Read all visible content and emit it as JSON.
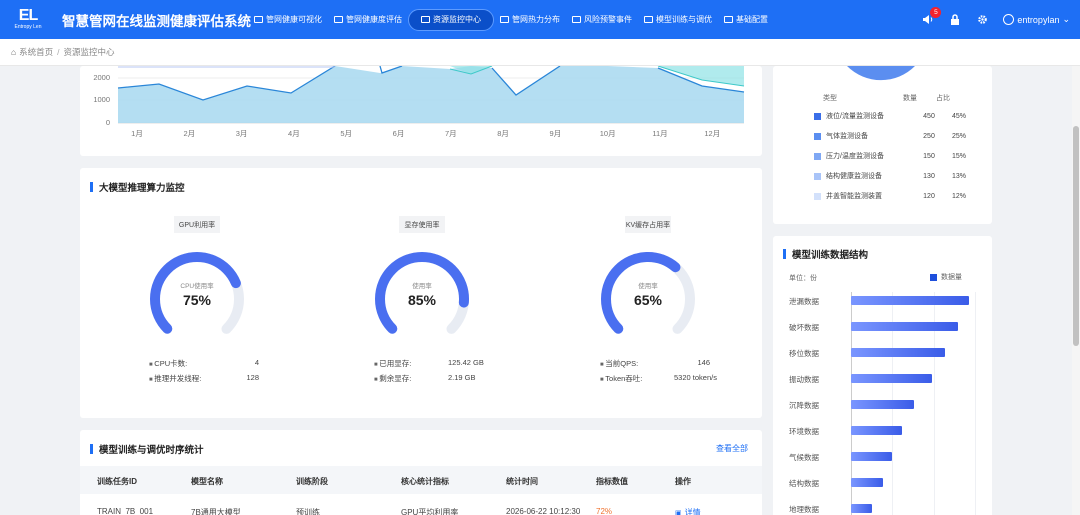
{
  "app": {
    "logo_mark": "EL",
    "logo_sub": "Entropy Len",
    "title": "智慧管网在线监测健康评估系统"
  },
  "nav": [
    {
      "label": "管网健康可视化",
      "icon": "dashboard-icon"
    },
    {
      "label": "管网健康度评估",
      "icon": "clipboard-icon"
    },
    {
      "label": "资源监控中心",
      "icon": "gear-icon",
      "active": true
    },
    {
      "label": "管网热力分布",
      "icon": "heat-icon"
    },
    {
      "label": "风险预警事件",
      "icon": "bell-icon"
    },
    {
      "label": "模型训练与调优",
      "icon": "chart-icon"
    },
    {
      "label": "基础配置",
      "icon": "settings-icon"
    }
  ],
  "header": {
    "notification_count": "5",
    "username": "entropylan"
  },
  "breadcrumb": {
    "home": "系统首页",
    "current": "资源监控中心"
  },
  "area_chart": {
    "y_ticks": [
      "2000",
      "1000",
      "0"
    ],
    "months": [
      "1月",
      "2月",
      "3月",
      "4月",
      "5月",
      "6月",
      "7月",
      "8月",
      "9月",
      "10月",
      "11月",
      "12月"
    ]
  },
  "compute": {
    "title": "大模型推理算力监控",
    "gauges": [
      {
        "label": "GPU利用率",
        "inner": "CPU使用率",
        "value": "75%",
        "percent": 75,
        "stats": [
          {
            "k": "CPU卡数:",
            "v": "4"
          },
          {
            "k": "推理并发线程:",
            "v": "128"
          }
        ]
      },
      {
        "label": "显存使用率",
        "inner": "使用率",
        "value": "85%",
        "percent": 85,
        "stats": [
          {
            "k": "已用显存:",
            "v": "125.42 GB"
          },
          {
            "k": "剩余显存:",
            "v": "2.19 GB"
          }
        ]
      },
      {
        "label": "KV缓存占用率",
        "inner": "使用率",
        "value": "65%",
        "percent": 65,
        "stats": [
          {
            "k": "当前QPS:",
            "v": "146"
          },
          {
            "k": "Token吞吐:",
            "v": "5320 token/s"
          }
        ]
      }
    ]
  },
  "table": {
    "title": "模型训练与调优时序统计",
    "view_all": "查看全部",
    "headers": [
      "训练任务ID",
      "模型名称",
      "训练阶段",
      "核心统计指标",
      "统计时间",
      "指标数值",
      "操作"
    ],
    "rows": [
      {
        "id": "TRAIN_7B_001",
        "model": "7B通用大模型",
        "stage": "预训练",
        "metric": "GPU平均利用率",
        "time": "2026-06-22 10:12:30",
        "value": "72%",
        "action": "详情"
      }
    ]
  },
  "device_dist": {
    "headers": {
      "type": "类型",
      "count": "数量",
      "ratio": "占比"
    },
    "rows": [
      {
        "name": "液位/流量监测设备",
        "count": "450",
        "ratio": "45%",
        "color": "#3a6ee8"
      },
      {
        "name": "气体监测设备",
        "count": "250",
        "ratio": "25%",
        "color": "#5b8ef0"
      },
      {
        "name": "压力/温度监测设备",
        "count": "150",
        "ratio": "15%",
        "color": "#7fa8f4"
      },
      {
        "name": "结构健康监测设备",
        "count": "130",
        "ratio": "13%",
        "color": "#a9c4f8"
      },
      {
        "name": "井盖智能监测装置",
        "count": "120",
        "ratio": "12%",
        "color": "#d3e1fb"
      }
    ]
  },
  "train_struct": {
    "title": "模型训练数据结构",
    "unit": "单位：份",
    "legend": "数据量",
    "chart_data": {
      "type": "bar",
      "categories": [
        "泄漏数据",
        "破坏数据",
        "移位数据",
        "振动数据",
        "沉降数据",
        "环境数据",
        "气候数据",
        "结构数据",
        "地理数据"
      ],
      "values": [
        100,
        91,
        80,
        69,
        53,
        43,
        35,
        27,
        18
      ],
      "xlim": [
        0,
        105
      ]
    }
  }
}
